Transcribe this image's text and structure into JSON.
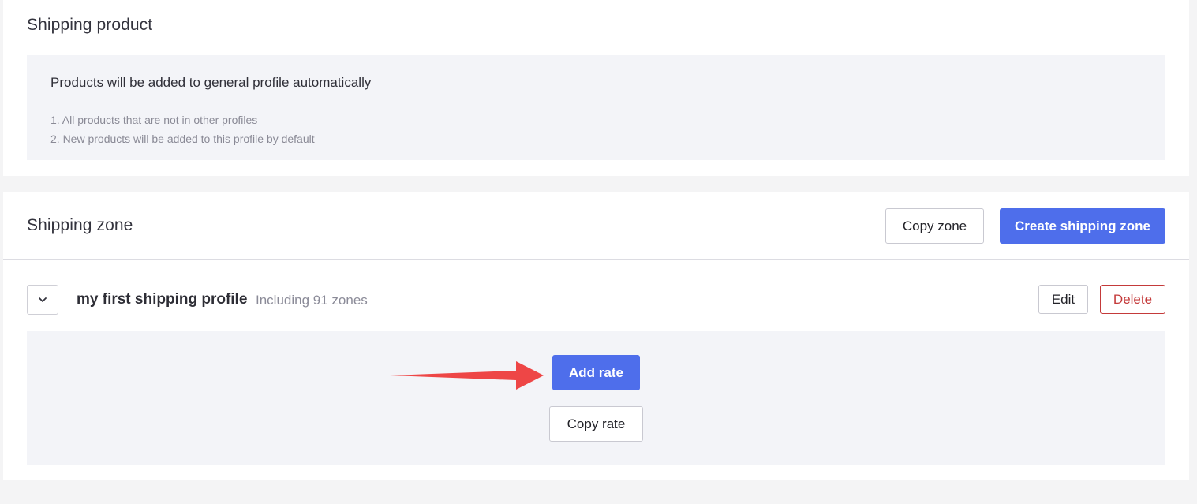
{
  "shipping_product": {
    "title": "Shipping product",
    "info_heading": "Products will be added to general profile automatically",
    "info_items": [
      "1. All products that are not in other profiles",
      "2. New products will be added to this profile by default"
    ]
  },
  "shipping_zone": {
    "title": "Shipping zone",
    "copy_zone_label": "Copy zone",
    "create_zone_label": "Create shipping zone",
    "profile": {
      "name": "my first shipping profile",
      "subtitle": "Including 91 zones",
      "edit_label": "Edit",
      "delete_label": "Delete",
      "add_rate_label": "Add rate",
      "copy_rate_label": "Copy rate"
    }
  },
  "colors": {
    "primary": "#4e6eeb",
    "danger": "#c43a3a",
    "annotation_arrow": "#ee4646",
    "panel_bg": "#f3f4f8"
  },
  "icons": {
    "toggle": "chevron-down-icon",
    "annotation": "red-arrow-icon"
  }
}
